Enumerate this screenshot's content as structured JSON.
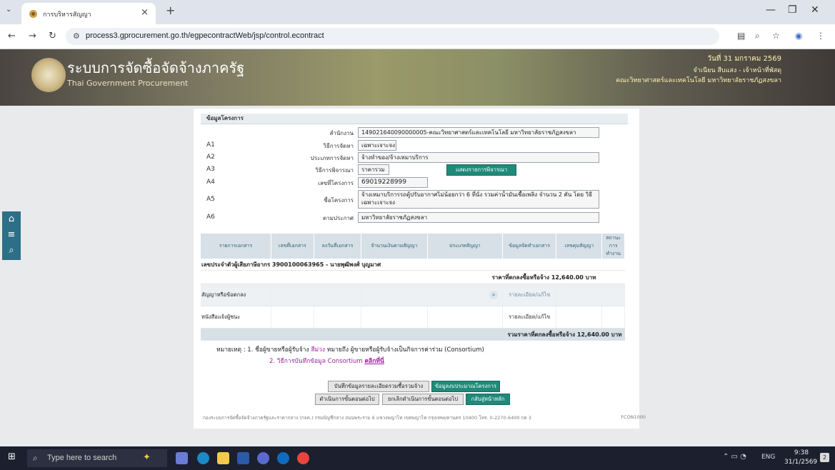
{
  "browser": {
    "tab_title": "การบริหารสัญญา",
    "tab_close": "×",
    "new_tab": "+",
    "url": "process3.gprocurement.go.th/egpecontractWeb/jsp/control.econtract"
  },
  "header": {
    "system_name": "ระบบการจัดซื้อจัดจ้างภาครัฐ",
    "system_name_en": "Thai Government Procurement",
    "date": "วันที่ 31 มกราคม 2569",
    "user": "จำเนียน สืบแสง - เจ้าหน้าที่พัสดุ",
    "agency": "คณะวิทยาศาสตร์และเทคโนโลยี มหาวิทยาลัยราชภัฏสงขลา"
  },
  "project": {
    "section_title": "ข้อมูลโครงการ",
    "office_label": "สำนักงาน",
    "office_value": "149021640090000005-คณะวิทยาศาสตร์และเทคโนโลยี มหาวิทยาลัยราชภัฏสงขลา",
    "fields": [
      {
        "code": "A1",
        "label": "วิธีการจัดหา",
        "value": "เฉพาะเจาะจง"
      },
      {
        "code": "A2",
        "label": "ประเภทการจัดหา",
        "value": "จ้างทำของ/จ้างเหมาบริการ"
      },
      {
        "code": "A3",
        "label": "วิธีการพิจารณา",
        "value": "ราคารวม"
      },
      {
        "code": "A4",
        "label": "เลขที่โครงการ",
        "value": "69019228999"
      },
      {
        "code": "A5",
        "label": "ชื่อโครงการ",
        "value": "จ้างเหมาบริการรถตู้ปรับอากาศไม่น้อยกว่า 6 ที่นั่ง รวมค่าน้ำมันเชื้อเพลิง จำนวน 2 คัน โดย วิธีเฉพาะเจาะจง"
      },
      {
        "code": "A6",
        "label": "ตามประกาศ",
        "value": "มหาวิทยาลัยราชภัฏสงขลา"
      }
    ],
    "show_criteria_button": "แสดงรายการพิจารณา"
  },
  "docs": {
    "headers": [
      "รายการเอกสาร",
      "เลขที่เอกสาร",
      "ลงวันที่เอกสาร",
      "จำนวนเงินตามสัญญา",
      "ประเภทสัญญา",
      "ข้อมูลจัดทำเอกสาร",
      "เลขคุมสัญญา",
      "สถานะการทำงาน"
    ],
    "taxpayer": "เลขประจำตัวผู้เสียภาษีอากร 3900100063965 - นายพุฒิพงศ์ บุญมาศ",
    "agreed_price": "ราคาที่ตกลงซื้อหรือจ้าง 12,640.00 บาท",
    "rows": [
      {
        "name": "สัญญาหรือข้อตกลง",
        "link": "รายละเอียด/แก้ไข"
      },
      {
        "name": "หนังสือแจ้งผู้ชนะ",
        "link": "รายละเอียด/แก้ไข"
      }
    ],
    "total": "รวมราคาที่ตกลงซื้อหรือจ้าง 12,640.00 บาท"
  },
  "notes": {
    "prefix": "หมายเหตุ : 1. ชื่อผู้ขายหรือผู้รับจ้าง",
    "color_word": "สีม่วง",
    "suffix": "หมายถึง ผู้ขายหรือผู้รับจ้างเป็นกิจการค่าร่วม (Consortium)",
    "line2": "2. วิธีการบันทึกข้อมูล Consortium",
    "line2_link": "คลิกที่นี่"
  },
  "buttons": {
    "save_detail": "บันทึกข้อมูลรายละเอียดรวมซื้อรวมจ้าง",
    "budget_info": "ข้อมูลงบประมาณโครงการ",
    "next_step": "ดำเนินการขั้นตอนต่อไป",
    "cancel_next": "ยกเลิกดำเนินการขั้นตอนต่อไป",
    "home": "กลับสู่หน้าหลัก"
  },
  "footer": {
    "address": "กองระบบการจัดซื้อจัดจ้างภาครัฐและราคากลาง (กจค.) กรมบัญชีกลาง ถนนพระราม 6 แขวงพญาไท เขตพญาไท กรุงเทพมหานคร 10400 โทร. 0-2270-6400 กด 3",
    "code": "FCON1000"
  },
  "taskbar": {
    "search_placeholder": "Type here to search",
    "lang": "ENG",
    "time": "9:38",
    "date": "31/1/2569",
    "notif_count": "2"
  },
  "colors": {
    "accent_green": "#1f8a7a",
    "header_blue": "#2d5f79",
    "consortium_purple": "#9b1fa0",
    "banner": "#7d7a62"
  }
}
